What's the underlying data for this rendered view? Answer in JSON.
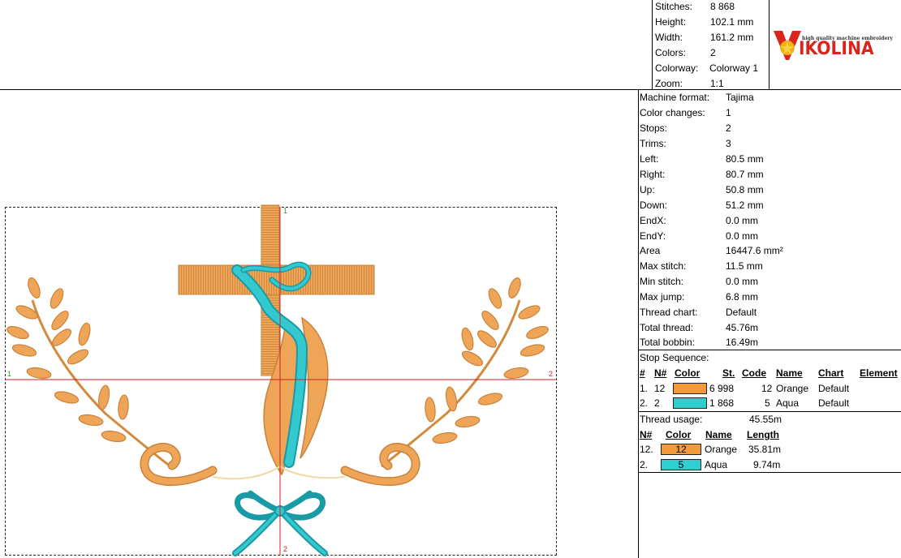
{
  "summary": {
    "stitches_label": "Stitches:",
    "stitches": "8 868",
    "height_label": "Height:",
    "height": "102.1 mm",
    "width_label": "Width:",
    "width": "161.2 mm",
    "colors_label": "Colors:",
    "colors": "2",
    "colorway_label": "Colorway:",
    "colorway": "Colorway 1",
    "zoom_label": "Zoom:",
    "zoom": "1:1"
  },
  "logo": {
    "tagline": "high quality machine embroidery",
    "wordmark": "IKOLINA",
    "accent": "#d9251c",
    "icon": "v-star-logo-icon"
  },
  "info": [
    {
      "k": "Machine format:",
      "v": "Tajima"
    },
    {
      "k": "Color changes:",
      "v": "1"
    },
    {
      "k": "Stops:",
      "v": "2"
    },
    {
      "k": "Trims:",
      "v": "3"
    },
    {
      "k": "Left:",
      "v": "80.5 mm"
    },
    {
      "k": "Right:",
      "v": "80.7 mm"
    },
    {
      "k": "Up:",
      "v": "50.8 mm"
    },
    {
      "k": "Down:",
      "v": "51.2 mm"
    },
    {
      "k": "EndX:",
      "v": "0.0 mm"
    },
    {
      "k": "EndY:",
      "v": "0.0 mm"
    },
    {
      "k": "Area",
      "v": "16447.6 mm²"
    },
    {
      "k": "Max stitch:",
      "v": "11.5 mm"
    },
    {
      "k": "Min stitch:",
      "v": "0.0 mm"
    },
    {
      "k": "Max jump:",
      "v": "6.8 mm"
    },
    {
      "k": "Thread chart:",
      "v": "Default"
    },
    {
      "k": "Total thread:",
      "v": "45.76m"
    },
    {
      "k": "Total bobbin:",
      "v": "16.49m"
    }
  ],
  "stop_sequence": {
    "title": "Stop Sequence:",
    "headers": {
      "num": "#",
      "n": "N#",
      "color": "Color",
      "st": "St.",
      "code": "Code",
      "name": "Name",
      "chart": "Chart",
      "element": "Element"
    },
    "rows": [
      {
        "num": "1.",
        "n": "12",
        "color": "#f39a3a",
        "st": "6 998",
        "code": "12",
        "name": "Orange",
        "chart": "Default"
      },
      {
        "num": "2.",
        "n": "2",
        "color": "#2ecfcf",
        "st": "1 868",
        "code": "5",
        "name": "Aqua",
        "chart": "Default"
      }
    ]
  },
  "thread_usage": {
    "title": "Thread usage:",
    "total": "45.55m",
    "headers": {
      "n": "N#",
      "color": "Color",
      "name": "Name",
      "length": "Length"
    },
    "rows": [
      {
        "n": "12.",
        "swatch": "12",
        "color": "#f39a3a",
        "name": "Orange",
        "length": "35.81m"
      },
      {
        "n": "2.",
        "swatch": "5",
        "color": "#2ecfcf",
        "name": "Aqua",
        "length": "9.74m"
      }
    ]
  },
  "design": {
    "marks": {
      "top": "1",
      "left": "1",
      "right": "2",
      "bottom": "2"
    },
    "colors": {
      "orange": "#eea557",
      "orange_dark": "#c9833a",
      "aqua": "#34c9cf",
      "aqua_dark": "#1a9aa5",
      "guide": "#d02020"
    }
  }
}
